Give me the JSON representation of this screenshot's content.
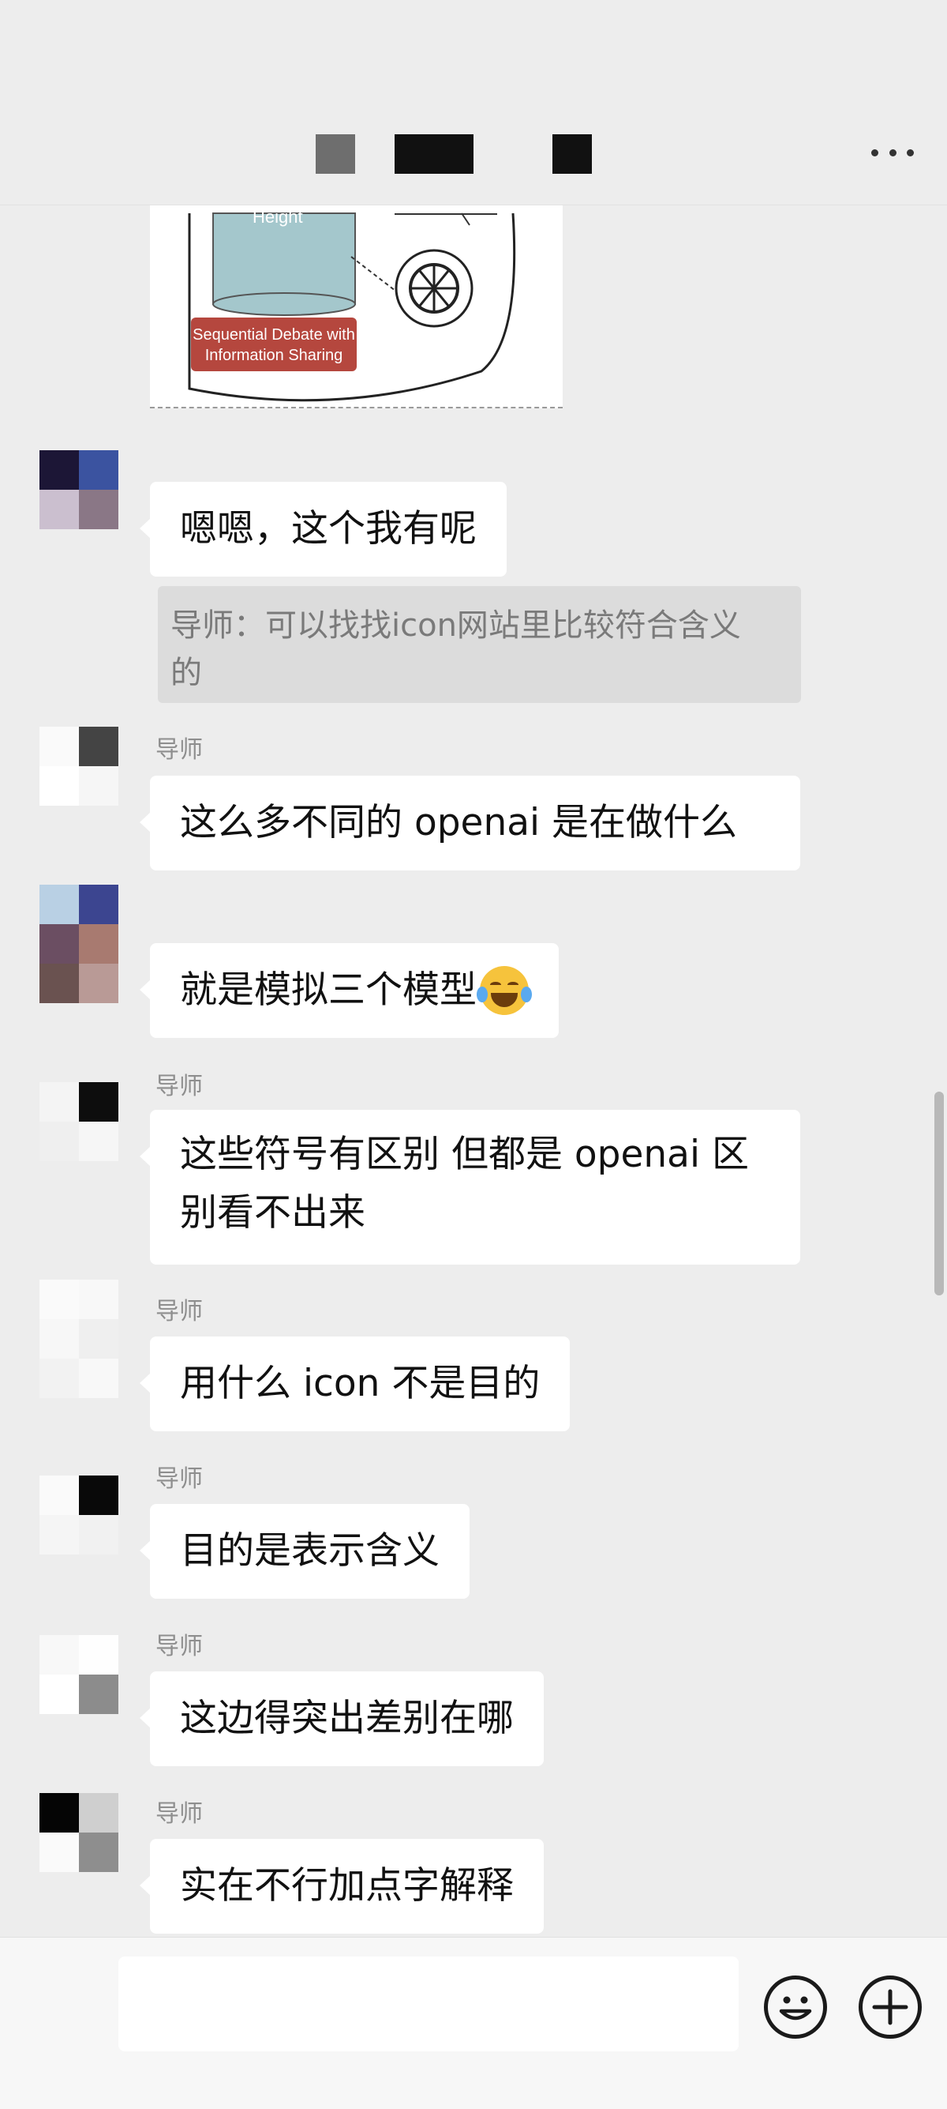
{
  "header": {
    "more_label": "more"
  },
  "image_message": {
    "box_text": "Height",
    "caption_line1": "Sequential Debate with",
    "caption_line2": "Information Sharing",
    "icon": "openai-logo-icon"
  },
  "messages": [
    {
      "sender": "",
      "text": "嗯嗯，这个我有呢"
    },
    {
      "sender": "导师",
      "text": "这么多不同的 openai 是在做什么"
    },
    {
      "sender": "",
      "text": "就是模拟三个模型",
      "emoji": "tears-of-joy-emoji"
    },
    {
      "sender": "导师",
      "line1": "这些符号有区别 但都是 openai 区",
      "line2": "别看不出来"
    },
    {
      "sender": "导师",
      "text": "用什么 icon 不是目的"
    },
    {
      "sender": "导师",
      "text": "目的是表示含义"
    },
    {
      "sender": "导师",
      "text": "这边得突出差别在哪"
    },
    {
      "sender": "导师",
      "text": "实在不行加点字解释"
    }
  ],
  "quote": {
    "line1": "导师：可以找找icon网站里比较符合含义",
    "line2": "的"
  },
  "input_bar": {
    "placeholder": "",
    "emoji_icon": "smiley-icon",
    "plus_icon": "plus-icon"
  },
  "colors": {
    "background": "#ededed",
    "bubble": "#ffffff",
    "quote_bg": "#dcdcdc"
  }
}
